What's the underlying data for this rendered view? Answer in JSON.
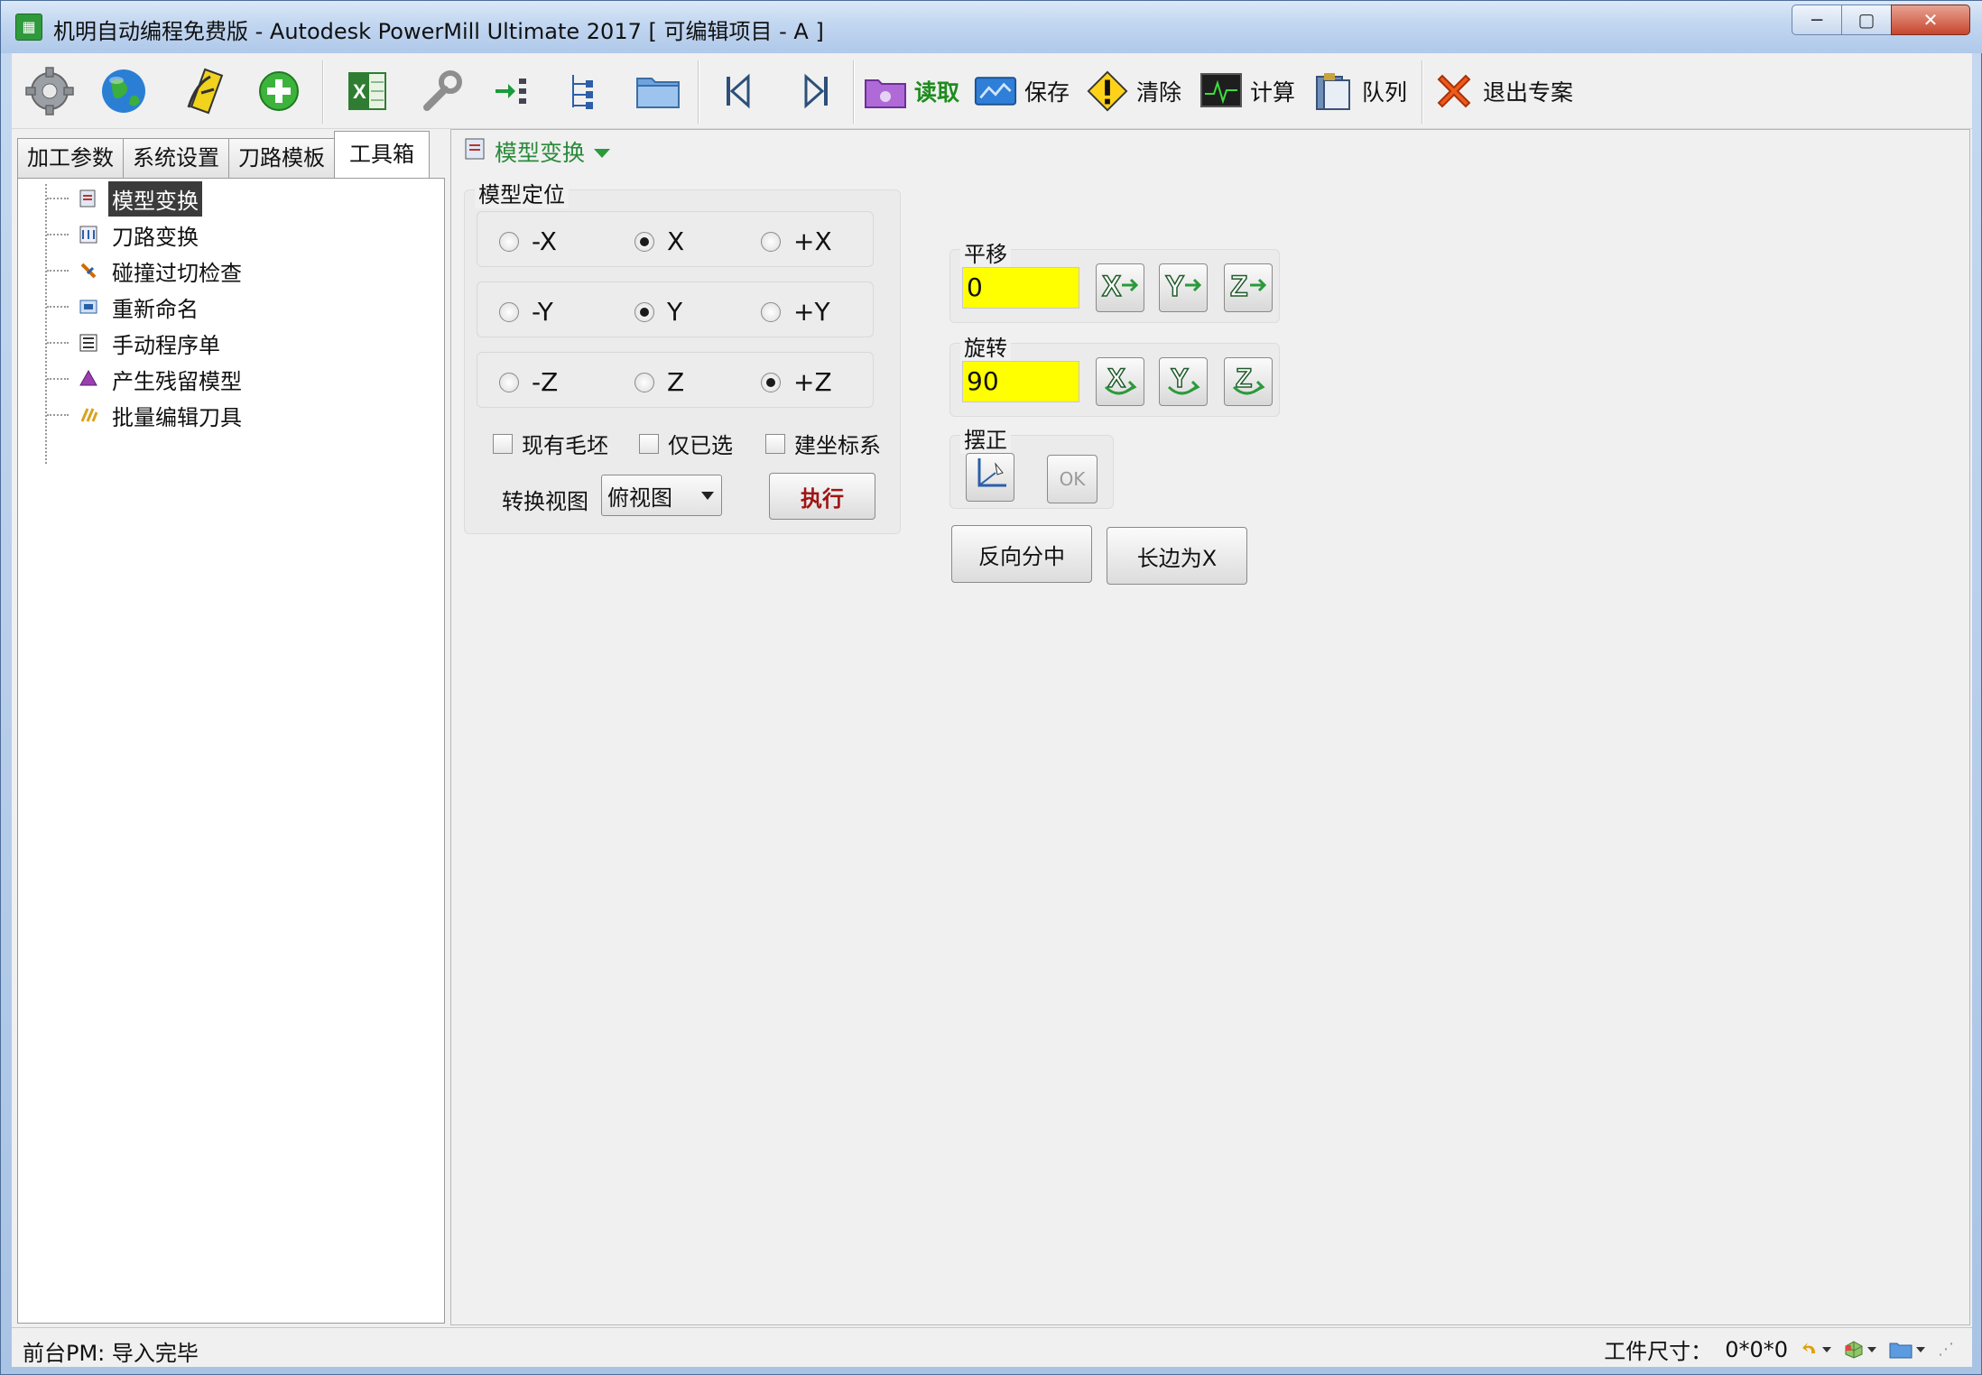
{
  "window": {
    "title": "机明自动编程免费版 - Autodesk PowerMill Ultimate 2017    [ 可编辑项目 - A ]",
    "icon": "app-icon",
    "controls": {
      "minimize": "─",
      "maximize": "▢",
      "close": "✕"
    }
  },
  "toolbar": {
    "icons": [
      "gear-icon",
      "globe-icon",
      "wand-icon",
      "add-icon",
      "excel-icon",
      "wrench-icon",
      "import-icon",
      "tree-icon",
      "folder-icon",
      "first-icon",
      "last-icon"
    ],
    "read_label": "读取",
    "save_label": "保存",
    "clear_label": "清除",
    "calc_label": "计算",
    "queue_label": "队列",
    "exit_label": "退出专案",
    "read_color": "#1e8c1e"
  },
  "left_panel": {
    "tabs": [
      "加工参数",
      "系统设置",
      "刀路模板",
      "工具箱"
    ],
    "active_tab": "工具箱",
    "tree_items": [
      {
        "label": "模型变换",
        "icon": "model-transform-icon",
        "selected": true
      },
      {
        "label": "刀路变换",
        "icon": "toolpath-transform-icon",
        "selected": false
      },
      {
        "label": "碰撞过切检查",
        "icon": "collision-check-icon",
        "selected": false
      },
      {
        "label": "重新命名",
        "icon": "rename-icon",
        "selected": false
      },
      {
        "label": "手动程序单",
        "icon": "manual-program-icon",
        "selected": false
      },
      {
        "label": "产生残留模型",
        "icon": "stock-model-icon",
        "selected": false
      },
      {
        "label": "批量编辑刀具",
        "icon": "batch-edit-tool-icon",
        "selected": false
      }
    ]
  },
  "main": {
    "header": "模型变换",
    "positioning": {
      "title": "模型定位",
      "rows": [
        {
          "options": [
            "-X",
            "X",
            "+X"
          ],
          "selected": 1
        },
        {
          "options": [
            "-Y",
            "Y",
            "+Y"
          ],
          "selected": 1
        },
        {
          "options": [
            "-Z",
            "Z",
            "+Z"
          ],
          "selected": 2
        }
      ],
      "checkboxes": [
        "现有毛坯",
        "仅已选",
        "建坐标系"
      ],
      "view_label": "转换视图",
      "view_value": "俯视图",
      "execute_label": "执行"
    },
    "translate": {
      "title": "平移",
      "value": "0"
    },
    "rotate": {
      "title": "旋转",
      "value": "90"
    },
    "align": {
      "title": "摆正",
      "ok_label": "OK"
    },
    "reverse_center_label": "反向分中",
    "long_side_label": "长边为X"
  },
  "status": {
    "left": "前台PM: 导入完毕",
    "size_label": "工件尺寸：",
    "size_value": "0*0*0"
  }
}
